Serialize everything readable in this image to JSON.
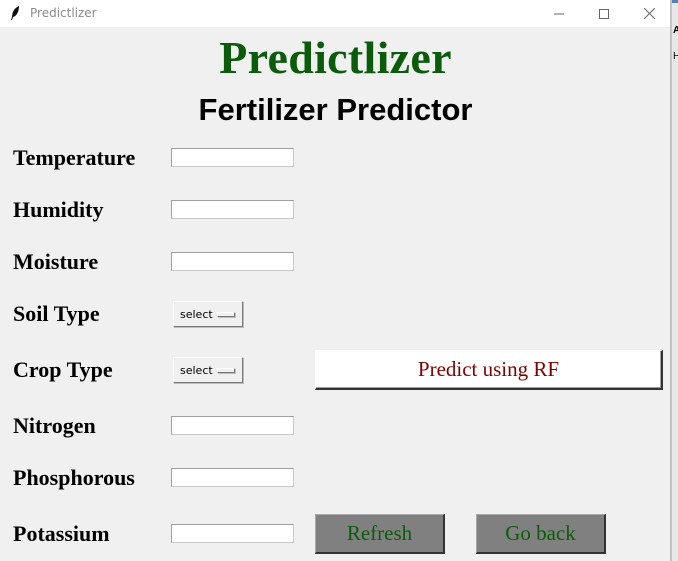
{
  "window": {
    "title": "Predictlizer",
    "icons": {
      "app": "feather-icon",
      "minimize": "minimize-icon",
      "maximize": "maximize-icon",
      "close": "close-icon"
    }
  },
  "background_window": {
    "chars": [
      "A",
      "H"
    ]
  },
  "header": {
    "title": "Predictlizer",
    "subtitle": "Fertilizer Predictor",
    "title_color": "#0a5c0a"
  },
  "form": {
    "temperature": {
      "label": "Temperature",
      "value": ""
    },
    "humidity": {
      "label": "Humidity",
      "value": ""
    },
    "moisture": {
      "label": "Moisture",
      "value": ""
    },
    "soil_type": {
      "label": "Soil Type",
      "selected": "select"
    },
    "crop_type": {
      "label": "Crop Type",
      "selected": "select"
    },
    "nitrogen": {
      "label": "Nitrogen",
      "value": ""
    },
    "phosphorous": {
      "label": "Phosphorous",
      "value": ""
    },
    "potassium": {
      "label": "Potassium",
      "value": ""
    }
  },
  "buttons": {
    "predict": {
      "label": "Predict using RF",
      "color": "#800000"
    },
    "refresh": {
      "label": "Refresh",
      "color": "#0a5c0a",
      "background": "#808080"
    },
    "go_back": {
      "label": "Go back",
      "color": "#0a5c0a",
      "background": "#808080"
    }
  }
}
